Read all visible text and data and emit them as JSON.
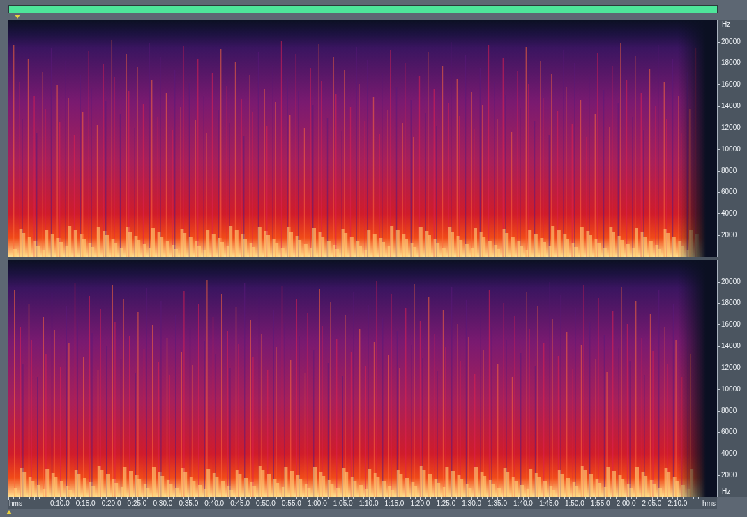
{
  "channels": [
    {
      "unit_top": "Hz",
      "frequency_labels": [
        "20000",
        "18000",
        "16000",
        "14000",
        "12000",
        "10000",
        "8000",
        "6000",
        "4000",
        "2000"
      ]
    },
    {
      "unit_bottom": "Hz",
      "frequency_labels": [
        "20000",
        "18000",
        "16000",
        "14000",
        "12000",
        "10000",
        "8000",
        "6000",
        "4000",
        "2000"
      ]
    }
  ],
  "time_ruler": {
    "start_label": "hms",
    "labels": [
      "0:10.0",
      "0:15.0",
      "0:20.0",
      "0:25.0",
      "0:30.0",
      "0:35.0",
      "0:40.0",
      "0:45.0",
      "0:50.0",
      "0:55.0",
      "1:00.0",
      "1:05.0",
      "1:10.0",
      "1:15.0",
      "1:20.0",
      "1:25.0",
      "1:30.0",
      "1:35.0",
      "1:40.0",
      "1:45.0",
      "1:50.0",
      "1:55.0",
      "2:00.0",
      "2:05.0",
      "2:10.0"
    ],
    "end_label": "hms"
  }
}
